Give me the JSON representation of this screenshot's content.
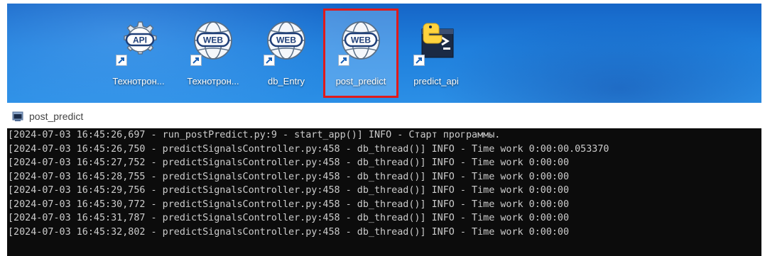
{
  "desktop": {
    "icons": [
      {
        "label": "Технотрон...",
        "icon": "api-gear-icon",
        "glyph": "API"
      },
      {
        "label": "Технотрон...",
        "icon": "web-globe-icon",
        "glyph": "WEB"
      },
      {
        "label": "db_Entry",
        "icon": "web-globe-icon",
        "glyph": "WEB"
      },
      {
        "label": "post_predict",
        "icon": "web-globe-icon",
        "glyph": "WEB",
        "selected": true
      },
      {
        "label": "predict_api",
        "icon": "python-terminal-icon"
      }
    ],
    "selection_color": "#e11b1b"
  },
  "window": {
    "title": "post_predict",
    "icon": "console-window-icon"
  },
  "console": {
    "lines": [
      "[2024-07-03 16:45:26,697 - run_postPredict.py:9 - start_app()] INFO - Старт программы.",
      "[2024-07-03 16:45:26,750 - predictSignalsController.py:458 - db_thread()] INFO - Time work 0:00:00.053370",
      "[2024-07-03 16:45:27,752 - predictSignalsController.py:458 - db_thread()] INFO - Time work 0:00:00",
      "[2024-07-03 16:45:28,755 - predictSignalsController.py:458 - db_thread()] INFO - Time work 0:00:00",
      "[2024-07-03 16:45:29,756 - predictSignalsController.py:458 - db_thread()] INFO - Time work 0:00:00",
      "[2024-07-03 16:45:30,772 - predictSignalsController.py:458 - db_thread()] INFO - Time work 0:00:00",
      "[2024-07-03 16:45:31,787 - predictSignalsController.py:458 - db_thread()] INFO - Time work 0:00:00",
      "[2024-07-03 16:45:32,802 - predictSignalsController.py:458 - db_thread()] INFO - Time work 0:00:00"
    ]
  }
}
